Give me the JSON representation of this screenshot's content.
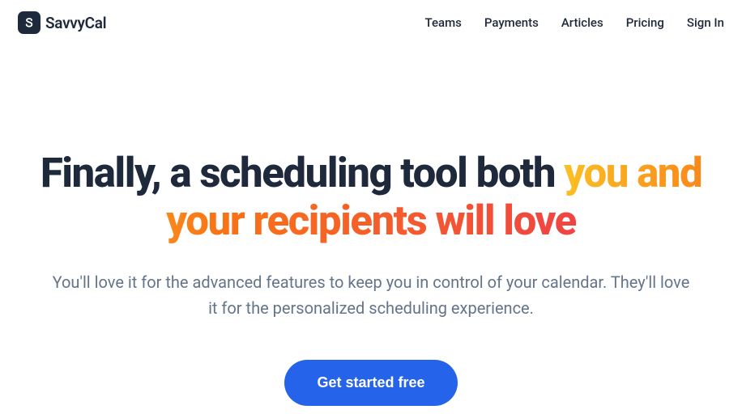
{
  "brand": {
    "name": "SavvyCal",
    "logo_letter": "S"
  },
  "nav": {
    "items": [
      "Teams",
      "Payments",
      "Articles",
      "Pricing",
      "Sign In"
    ]
  },
  "hero": {
    "title_plain": "Finally, a scheduling tool both ",
    "title_gradient": "you and your recipients will love",
    "subtitle": "You'll love it for the advanced features to keep you in control of your calendar. They'll love it for the personalized scheduling experience.",
    "cta_label": "Get started free"
  },
  "colors": {
    "text_primary": "#1e293b",
    "text_secondary": "#64748b",
    "accent_blue": "#2563eb",
    "gradient_start": "#fbbf24",
    "gradient_mid": "#f97316",
    "gradient_end": "#ef4444"
  }
}
